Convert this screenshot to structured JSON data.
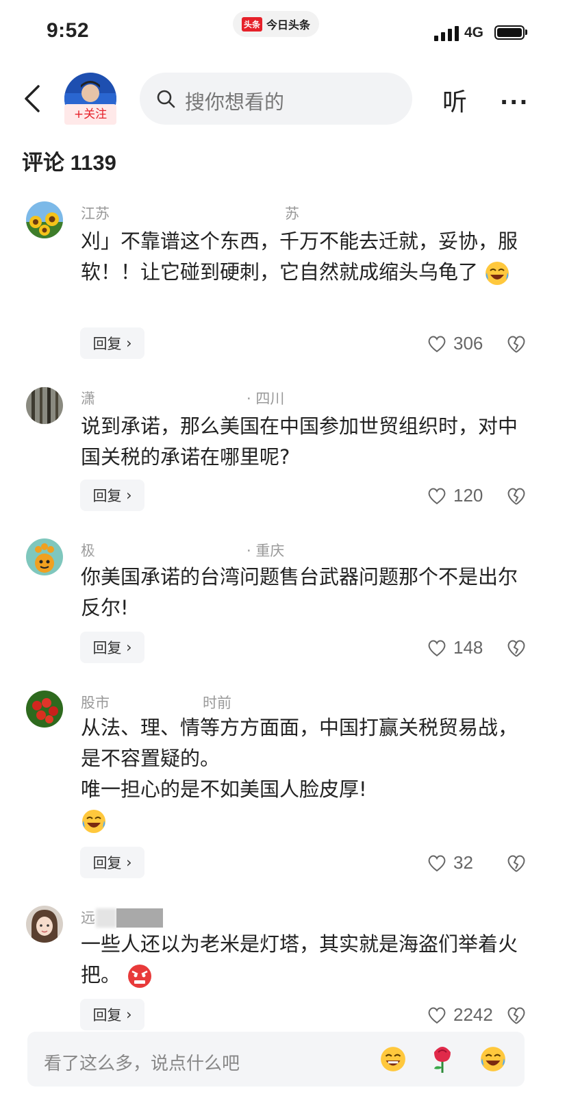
{
  "status": {
    "time": "9:52",
    "network": "4G",
    "app_logo": "头条",
    "app_name": "今日头条"
  },
  "nav": {
    "follow_label": "+关注",
    "search_placeholder": "搜你想看的",
    "listen_label": "听",
    "more_label": "···"
  },
  "comments_header": "评论 1139",
  "comments": [
    {
      "name_left": "江苏",
      "name_right": "苏",
      "text": "刈」不靠谱这个东西，千万不能去迁就，妥协，服软！！让它碰到硬刺，它自然就成缩头乌龟了",
      "emoji": "laughing-crying",
      "reply": "回复",
      "likes": "306"
    },
    {
      "name_left": "潇",
      "name_right": "· 四川",
      "text": "说到承诺，那么美国在中国参加世贸组织时，对中国关税的承诺在哪里呢?",
      "emoji": "",
      "reply": "回复",
      "likes": "120"
    },
    {
      "name_left": "极",
      "name_right": "· 重庆",
      "text": "你美国承诺的台湾问题售台武器问题那个不是出尔反尔!",
      "emoji": "",
      "reply": "回复",
      "likes": "148"
    },
    {
      "name_left": "股市",
      "name_right": "时前",
      "text_line1": "从法、理、情等方方面面，中国打赢关税贸易战，是不容置疑的。",
      "text_line2": "唯一担心的是不如美国人脸皮厚!",
      "emoji": "laughing-crying",
      "reply": "回复",
      "likes": "32"
    },
    {
      "name_left": "远",
      "name_right": "",
      "text": "一些人还以为老米是灯塔，其实就是海盗们举着火把。",
      "emoji": "angry",
      "reply": "回复",
      "likes": "2242"
    }
  ],
  "bottom": {
    "placeholder": "看了这么多，说点什么吧"
  },
  "colors": {
    "accent_red": "#e6212a",
    "text_grey": "#999999"
  }
}
